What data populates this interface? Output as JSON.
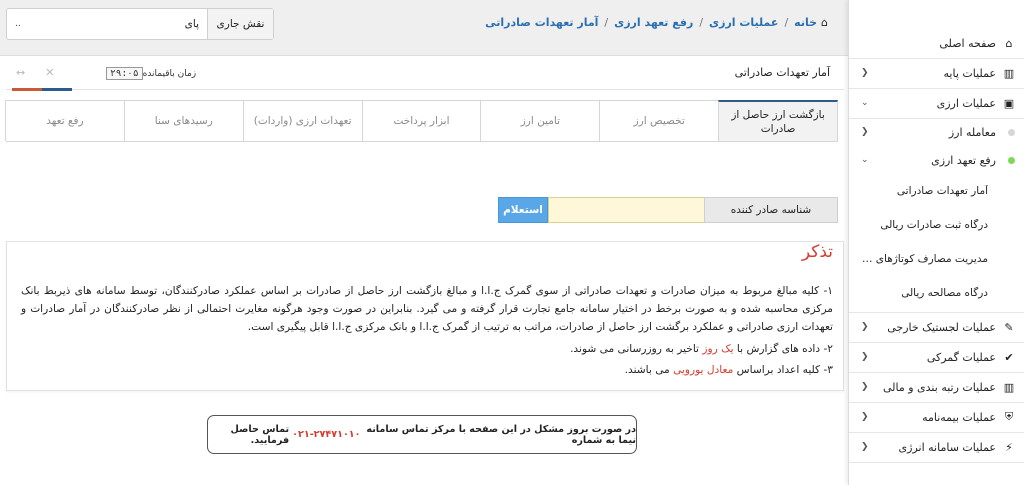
{
  "sidebar": {
    "items": [
      {
        "label": "صفحه اصلی",
        "icon": "home-icon",
        "chevron": false
      },
      {
        "label": "عملیات پایه",
        "icon": "bar-chart-icon",
        "chevron": "left"
      },
      {
        "label": "عملیات ارزی",
        "icon": "money-icon",
        "chevron": "down"
      }
    ],
    "sub_items": [
      {
        "label": "معامله ارز",
        "dot_color": "#d6d6d6",
        "chevron": "left"
      },
      {
        "label": "رفع تعهد ارزی",
        "dot_color": "#7ed957",
        "chevron": "down"
      }
    ],
    "leaves": [
      {
        "label": "آمار تعهدات صادراتی"
      },
      {
        "label": "درگاه ثبت صادرات ریالی"
      },
      {
        "label": "مدیریت مصارف کوتاژهای صا..."
      },
      {
        "label": "درگاه مصالحه ریالی"
      }
    ],
    "bottom_items": [
      {
        "label": "عملیات لجستیک خارجی",
        "icon": "edit-icon",
        "chevron": "left"
      },
      {
        "label": "عملیات گمرکی",
        "icon": "check-icon",
        "chevron": "left"
      },
      {
        "label": "عملیات رتبه بندی و مالی",
        "icon": "bar-chart-icon",
        "chevron": "left"
      },
      {
        "label": "عملیات بیمه‌نامه",
        "icon": "shield-icon",
        "chevron": "left"
      },
      {
        "label": "عملیات سامانه انرژی",
        "icon": "bolt-icon",
        "chevron": "left"
      }
    ]
  },
  "breadcrumb": {
    "home": "خانه",
    "items": [
      "عملیات ارزی",
      "رفع تعهد ارزی",
      "آمار تعهدات صادراتی"
    ],
    "separator": "/"
  },
  "role": {
    "label": "نقش جاری",
    "value": "پای",
    "suffix": ".."
  },
  "panel": {
    "title": "آمار تعهدات صادراتی",
    "timer_label": "زمان باقیمانده",
    "timer_value": "۲۹:۰۵"
  },
  "tabs": [
    {
      "label": "بازگشت ارز حاصل از صادرات",
      "active": true
    },
    {
      "label": "تخصیص ارز",
      "active": false
    },
    {
      "label": "تامین ارز",
      "active": false
    },
    {
      "label": "ابزار پرداخت",
      "active": false
    },
    {
      "label": "تعهدات ارزی (واردات)",
      "active": false
    },
    {
      "label": "رسیدهای سنا",
      "active": false
    },
    {
      "label": "رفع تعهد",
      "active": false
    }
  ],
  "inquiry": {
    "label": "شناسه صادر کننده",
    "input_value": "",
    "button_label": "استعلام"
  },
  "notice": {
    "title": "تذکر",
    "p1": "۱- کلیه مبالغ مربوط به میزان صادرات و تعهدات صادراتی از سوی گمرک ج.ا.ا و مبالغ بازگشت ارز حاصل از صادرات بر اساس عملکرد صادرکنندگان، توسط سامانه های ذیربط بانک مرکزی محاسبه شده و به صورت برخط در اختیار سامانه جامع تجارت قرار گرفته و می گیرد. بنابراین در صورت وجود هرگونه مغایرت احتمالی از نظر صادرکنندگان در آمار صادرات و تعهدات ارزی صادراتی و عملکرد برگشت ارز حاصل از صادرات، مراتب به ترتیب از گمرک ج.ا.ا و بانک مرکزی ج.ا.ا قابل پیگیری است.",
    "p2_before": "۲- داده های گزارش با ",
    "p2_highlight": "یک روز",
    "p2_after": " تاخیر به روزرسانی می شوند.",
    "p3_before": "۳- کلیه اعداد براساس ",
    "p3_highlight": "معادل یورویی",
    "p3_after": " می باشند."
  },
  "contact": {
    "before": "در صورت بروز مشکل در این صفحه با مرکز تماس سامانه نیما به شماره",
    "phone": "۰۲۱-۲۷۴۷۱۰۱۰",
    "after": "تماس حاصل فرمایید."
  },
  "colors": {
    "accent_blue": "#2d5b8a",
    "accent_red": "#d63b2f",
    "link": "#2a6fb0",
    "button": "#5aa7e8",
    "input_bg": "#fff8d8"
  }
}
